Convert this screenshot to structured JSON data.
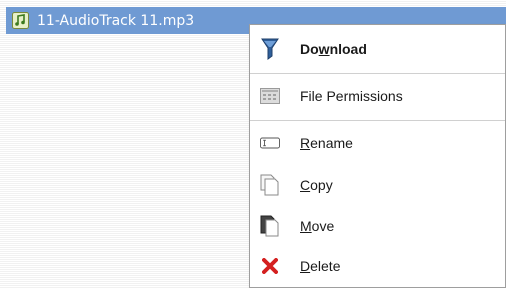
{
  "file": {
    "name": "11-AudioTrack 11.mp3",
    "icon": "audio-file-icon",
    "selected_color": "#6f9ad3"
  },
  "menu": {
    "items": [
      {
        "pre": "Do",
        "u": "w",
        "post": "nload",
        "icon": "download-icon",
        "bold": true
      },
      {
        "pre": "File Permissions",
        "u": "",
        "post": "",
        "icon": "permissions-icon",
        "bold": false
      },
      {
        "pre": "",
        "u": "R",
        "post": "ename",
        "icon": "rename-icon",
        "bold": false
      },
      {
        "pre": "",
        "u": "C",
        "post": "opy",
        "icon": "copy-icon",
        "bold": false
      },
      {
        "pre": "",
        "u": "M",
        "post": "ove",
        "icon": "move-icon",
        "bold": false
      },
      {
        "pre": "",
        "u": "D",
        "post": "elete",
        "icon": "delete-icon",
        "bold": false
      }
    ],
    "delete_color": "#d42020"
  }
}
